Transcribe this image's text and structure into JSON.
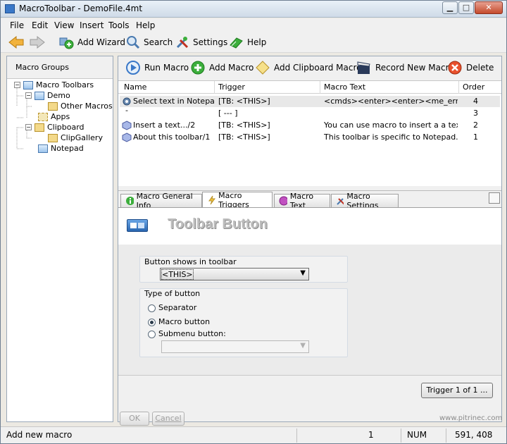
{
  "window": {
    "title": "MacroToolbar - DemoFile.4mt"
  },
  "menu": [
    "File",
    "Edit",
    "View",
    "Insert",
    "Tools",
    "Help"
  ],
  "toolbar": {
    "add_wizard": "Add Wizard",
    "search": "Search",
    "settings": "Settings",
    "help": "Help"
  },
  "left": {
    "header": "Macro Groups",
    "tree": [
      {
        "label": "Macro Toolbars"
      },
      {
        "label": "Demo"
      },
      {
        "label": "Other Macros"
      },
      {
        "label": "Apps"
      },
      {
        "label": "Clipboard"
      },
      {
        "label": "ClipGallery"
      },
      {
        "label": "Notepad"
      }
    ]
  },
  "right_toolbar": {
    "run": "Run Macro",
    "add": "Add Macro",
    "clip": "Add Clipboard Macro",
    "record": "Record New Macro",
    "delete": "Delete"
  },
  "grid": {
    "columns": [
      "Name",
      "Trigger",
      "Macro Text",
      "Order"
    ],
    "rows": [
      {
        "name": "Select text in Notepad ...",
        "trigger": "[TB: <THIS>]",
        "text": "<cmds><enter><enter><me_error_nodi...",
        "order": "4"
      },
      {
        "name": "-",
        "trigger": "[ --- ]",
        "text": "",
        "order": "3"
      },
      {
        "name": "Insert a text.../2",
        "trigger": "[TB: <THIS>]",
        "text": "You can use macro to insert a a text lik...",
        "order": "2"
      },
      {
        "name": "About this toolbar/1",
        "trigger": "[TB: <THIS>]",
        "text": "This toolbar is specific to Notepad.  It a...",
        "order": "1"
      }
    ]
  },
  "tabs": [
    "Macro General Info",
    "Macro Triggers",
    "Macro Text",
    "Macro Settings"
  ],
  "panel": {
    "heading": "Toolbar Button",
    "shows_label": "Button shows in toolbar",
    "shows_value": "<THIS>",
    "type_label": "Type of button",
    "opt_separator": "Separator",
    "opt_macro": "Macro button",
    "opt_submenu": "Submenu button:"
  },
  "bottom": {
    "trigger_btn": "Trigger 1 of 1 ...",
    "ok": "OK",
    "cancel": "Cancel",
    "url": "www.pitrinec.com"
  },
  "status": {
    "message": "Add new macro",
    "count": "1",
    "num": "NUM",
    "coords": "591, 408"
  }
}
